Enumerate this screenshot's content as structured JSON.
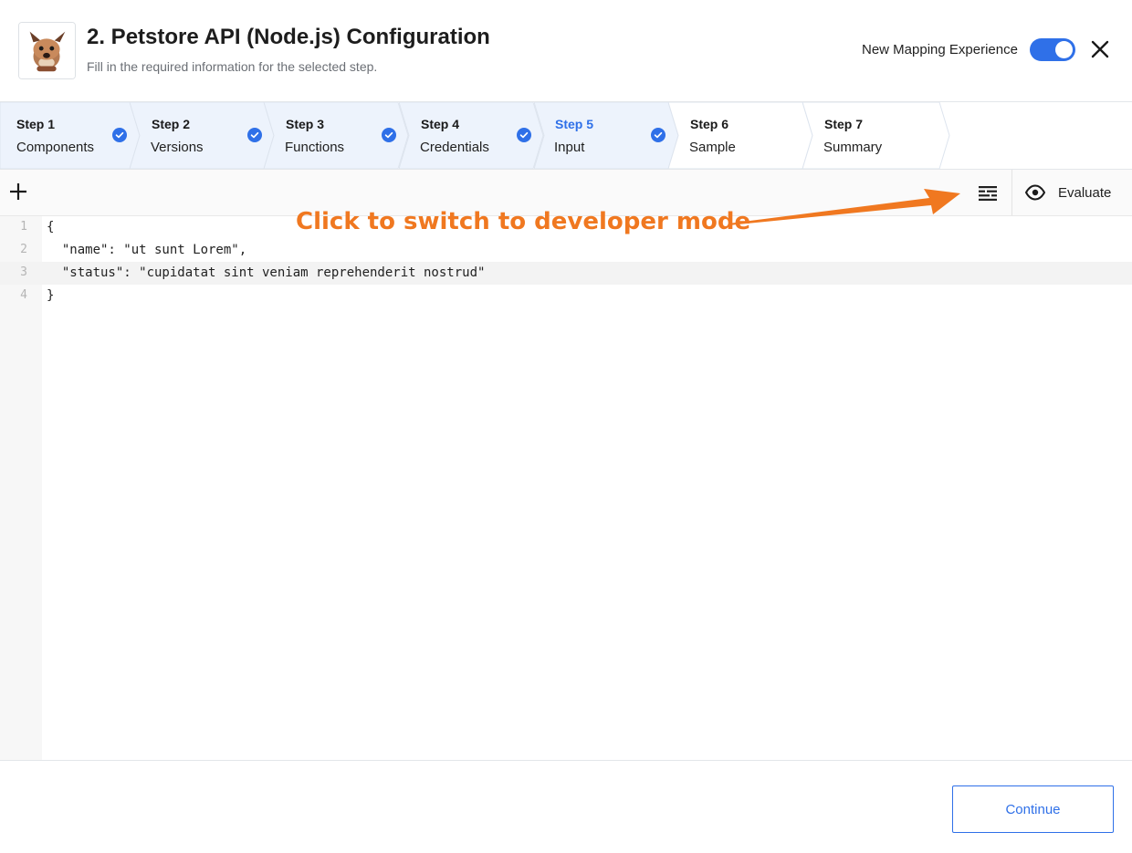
{
  "header": {
    "title": "2. Petstore API (Node.js) Configuration",
    "subtitle": "Fill in the required information for the selected step.",
    "toggle_label": "New Mapping Experience",
    "toggle_on": true,
    "avatar_icon": "bulldog-avatar-icon",
    "close_icon": "close-icon"
  },
  "steps": [
    {
      "num": "Step 1",
      "name": "Components",
      "state": "completed"
    },
    {
      "num": "Step 2",
      "name": "Versions",
      "state": "completed"
    },
    {
      "num": "Step 3",
      "name": "Functions",
      "state": "completed"
    },
    {
      "num": "Step 4",
      "name": "Credentials",
      "state": "completed"
    },
    {
      "num": "Step 5",
      "name": "Input",
      "state": "active-completed"
    },
    {
      "num": "Step 6",
      "name": "Sample",
      "state": "pending"
    },
    {
      "num": "Step 7",
      "name": "Summary",
      "state": "pending"
    }
  ],
  "toolbar": {
    "add_icon": "plus-icon",
    "devmode_icon": "developer-mode-icon",
    "evaluate_icon": "eye-icon",
    "evaluate_label": "Evaluate"
  },
  "editor": {
    "lines": [
      {
        "num": "1",
        "code": "{"
      },
      {
        "num": "2",
        "code": "  \"name\": \"ut sunt Lorem\","
      },
      {
        "num": "3",
        "code": "  \"status\": \"cupidatat sint veniam reprehenderit nostrud\""
      },
      {
        "num": "4",
        "code": "}"
      }
    ],
    "highlighted_line": 3
  },
  "annotation": {
    "text": "Click to switch to developer mode"
  },
  "footer": {
    "continue_label": "Continue"
  },
  "colors": {
    "accent": "#2f70e8",
    "annotation": "#f07820",
    "completed_step_bg": "#edf3fc"
  }
}
